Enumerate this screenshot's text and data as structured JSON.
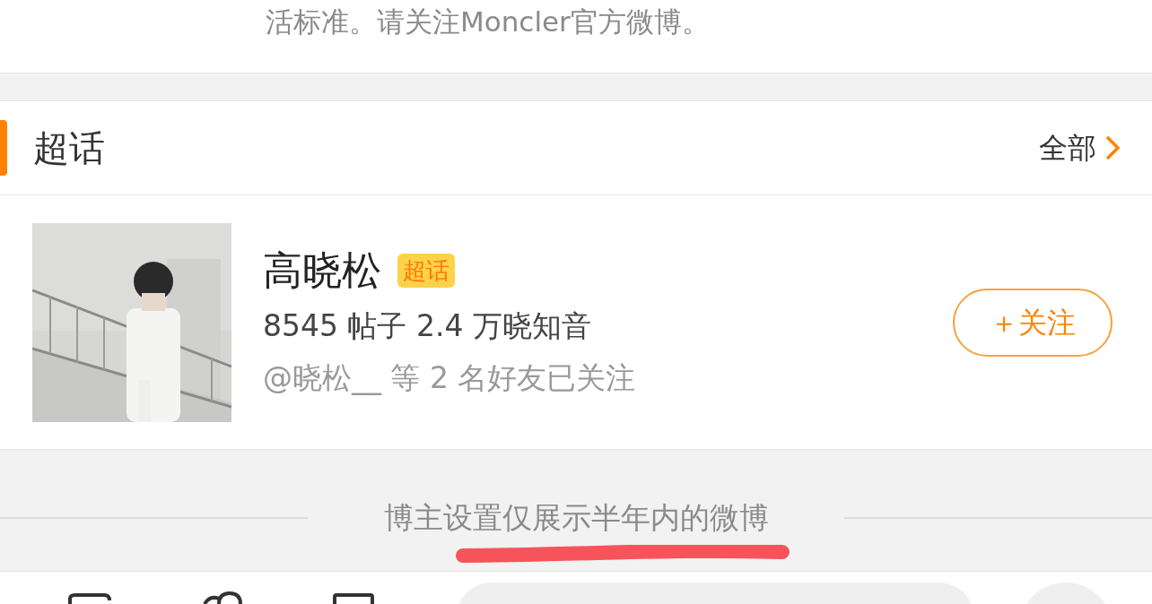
{
  "intro": {
    "text": "活标准。请关注Moncler官方微博。"
  },
  "section": {
    "title": "超话",
    "more": "全部"
  },
  "topic": {
    "kind": "picture",
    "name": "高晓松",
    "badge": "超话",
    "stats": "8545 帖子 2.4 万晓知音",
    "friends": "@晓松__ 等 2 名好友已关注",
    "follow": "＋关注"
  },
  "notice": "博主设置仅展示半年内的微博"
}
